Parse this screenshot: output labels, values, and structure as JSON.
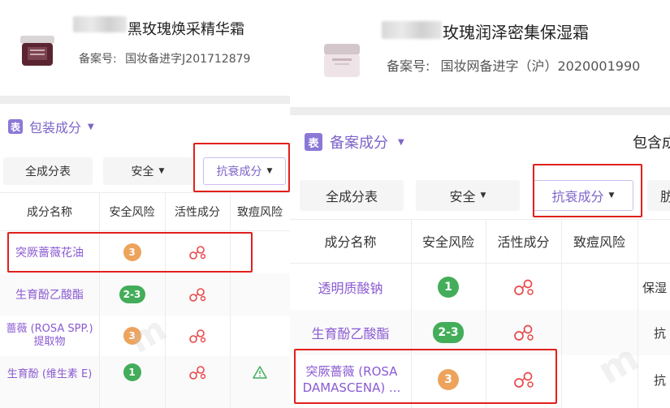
{
  "left": {
    "product": {
      "title": "黑玫瑰焕采精华霜",
      "reg_label": "备案号:",
      "reg_value": "国妆备进字J201712879"
    },
    "section": {
      "icon": "表",
      "title": "包装成分"
    },
    "tabs": [
      "全成分表",
      "安全",
      "抗衰成分"
    ],
    "columns": [
      "成分名称",
      "安全风险",
      "活性成分",
      "致痘风险"
    ],
    "rows": [
      {
        "name": "突厥蔷薇花油",
        "risk": "3",
        "risk_color": "orange",
        "active": "molecule-icon",
        "acne": ""
      },
      {
        "name": "生育酚乙酸酯",
        "risk": "2-3",
        "risk_color": "green",
        "active": "molecule-icon",
        "acne": ""
      },
      {
        "name": "蔷薇 (ROSA SPP.) 提取物",
        "risk": "3",
        "risk_color": "orange",
        "active": "molecule-icon",
        "acne": ""
      },
      {
        "name": "生育酚 (维生素 E)",
        "risk": "1",
        "risk_color": "green",
        "active": "molecule-icon",
        "acne": "warning-icon"
      }
    ]
  },
  "right": {
    "product": {
      "title": "玫瑰润泽密集保湿霜",
      "reg_label": "备案号:",
      "reg_value": "国妆网备进字（沪）2020001990"
    },
    "section": {
      "icon": "表",
      "title": "备案成分",
      "extra": "包含成"
    },
    "tabs": [
      "全成分表",
      "安全",
      "抗衰成分",
      "肪"
    ],
    "columns": [
      "成分名称",
      "安全风险",
      "活性成分",
      "致痘风险"
    ],
    "rows": [
      {
        "name": "透明质酸钠",
        "risk": "1",
        "risk_color": "green",
        "active": "molecule-icon",
        "extra": "保湿"
      },
      {
        "name": "生育酚乙酸酯",
        "risk": "2-3",
        "risk_color": "green",
        "active": "molecule-icon",
        "extra": "抗"
      },
      {
        "name": "突厥蔷薇 (ROSA DAMASCENA) ...",
        "risk": "3",
        "risk_color": "orange",
        "active": "molecule-icon",
        "extra": "抗"
      }
    ]
  },
  "colors": {
    "accent": "#7d64c8",
    "highlight": "#e0201c",
    "orange": "#eda35c",
    "green": "#43ad5a"
  }
}
